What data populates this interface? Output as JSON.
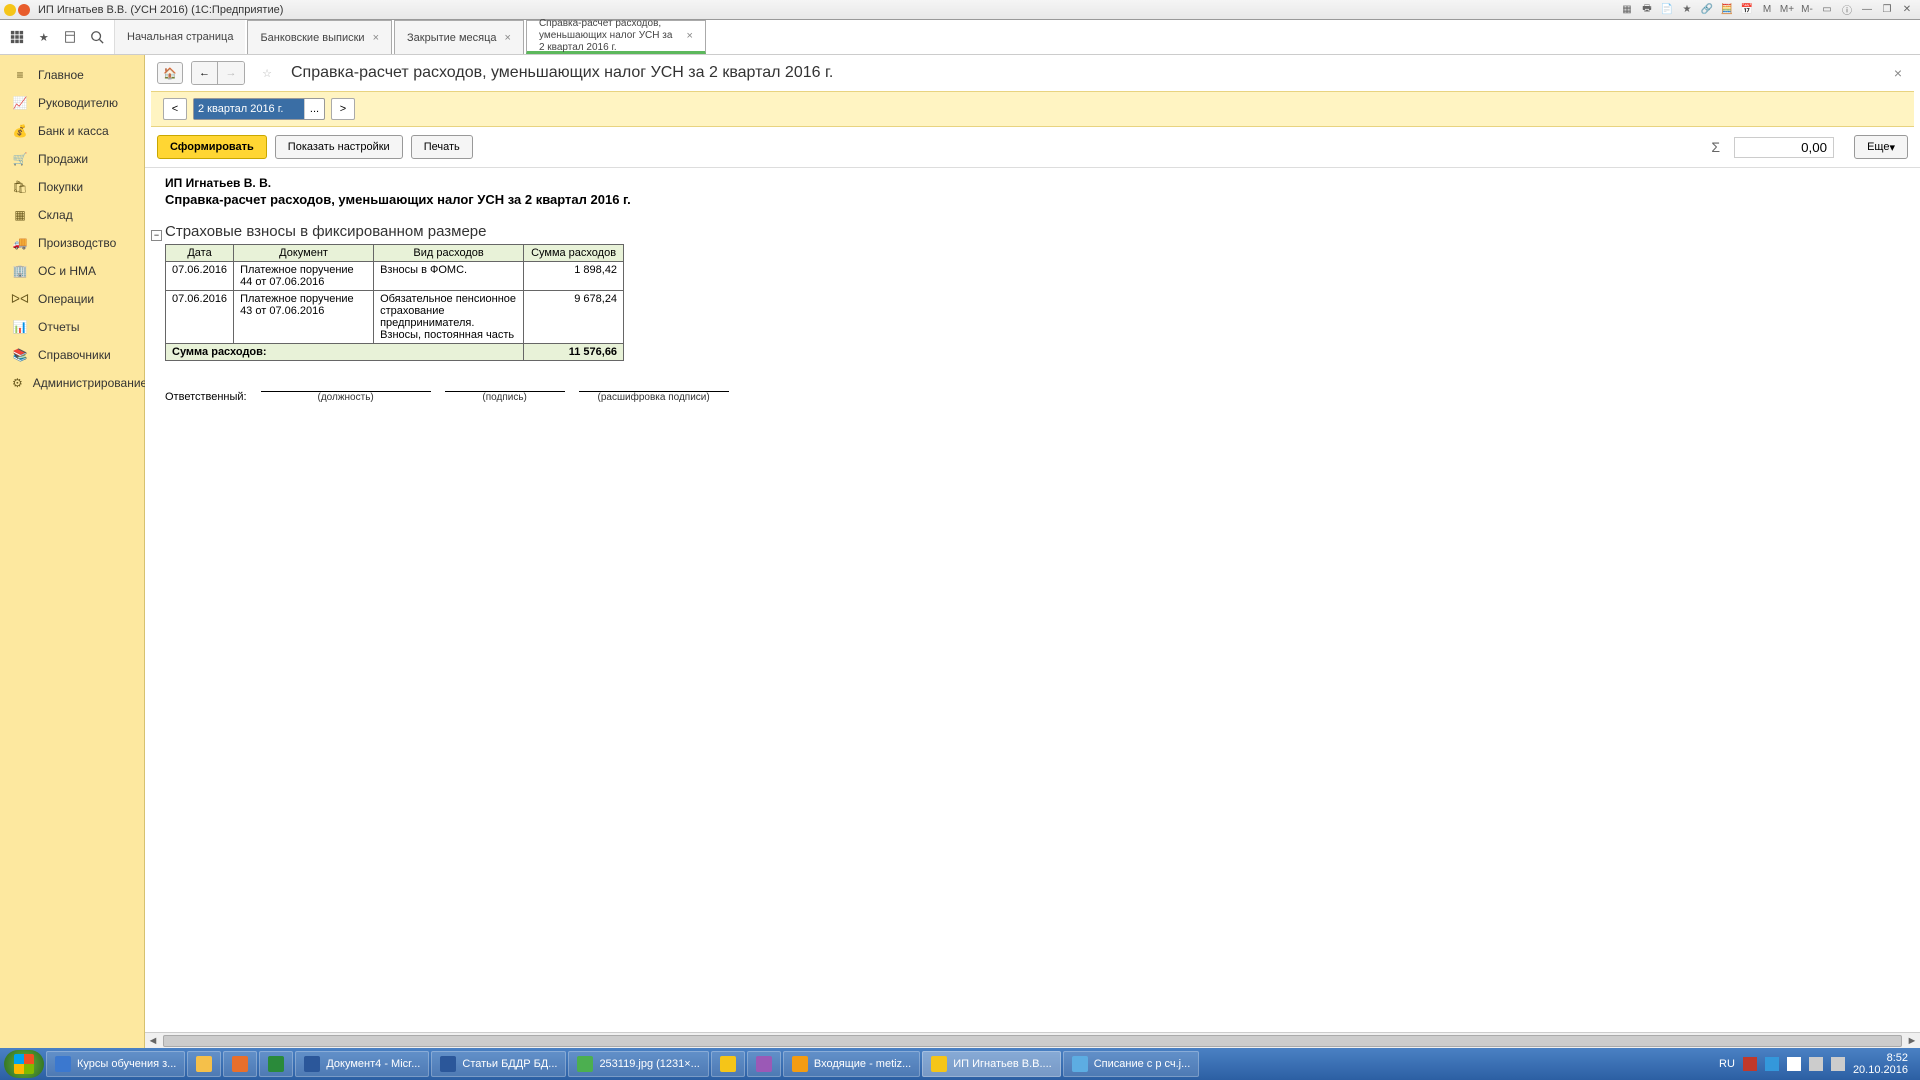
{
  "titlebar": {
    "title": "ИП Игнатьев В.В. (УСН 2016)  (1С:Предприятие)",
    "memory_labels": [
      "M",
      "M+",
      "M-"
    ]
  },
  "tabs": [
    {
      "label": "Начальная страница",
      "closeable": false
    },
    {
      "label": "Банковские выписки",
      "closeable": true
    },
    {
      "label": "Закрытие месяца",
      "closeable": true
    },
    {
      "label": "Справка-расчет расходов, уменьшающих налог УСН  за 2 квартал 2016 г.",
      "closeable": true,
      "active": true
    }
  ],
  "sidebar": [
    {
      "icon": "menu",
      "label": "Главное"
    },
    {
      "icon": "trend",
      "label": "Руководителю"
    },
    {
      "icon": "bank",
      "label": "Банк и касса"
    },
    {
      "icon": "cart",
      "label": "Продажи"
    },
    {
      "icon": "basket",
      "label": "Покупки"
    },
    {
      "icon": "boxes",
      "label": "Склад"
    },
    {
      "icon": "truck",
      "label": "Производство"
    },
    {
      "icon": "asset",
      "label": "ОС и НМА"
    },
    {
      "icon": "ops",
      "label": "Операции"
    },
    {
      "icon": "chart",
      "label": "Отчеты"
    },
    {
      "icon": "book",
      "label": "Справочники"
    },
    {
      "icon": "gear",
      "label": "Администрирование"
    }
  ],
  "page": {
    "title": "Справка-расчет расходов, уменьшающих налог УСН  за 2 квартал 2016 г.",
    "period_prev": "<",
    "period_value": "2 квартал 2016 г.",
    "period_next": ">",
    "btn_generate": "Сформировать",
    "btn_settings": "Показать настройки",
    "btn_print": "Печать",
    "sum_value": "0,00",
    "btn_more": "Еще"
  },
  "report": {
    "company": "ИП Игнатьев В. В.",
    "subtitle": "Справка-расчет расходов, уменьшающих налог УСН  за 2 квартал 2016 г.",
    "section": "Страховые взносы в фиксированном размере",
    "columns": [
      "Дата",
      "Документ",
      "Вид расходов",
      "Сумма расходов"
    ],
    "rows": [
      {
        "date": "07.06.2016",
        "doc": "Платежное поручение 44 от 07.06.2016",
        "kind": "Взносы в ФОМС.",
        "sum": "1 898,42"
      },
      {
        "date": "07.06.2016",
        "doc": "Платежное поручение 43 от 07.06.2016",
        "kind": "Обязательное пенсионное страхование предпринимателя. Взносы, постоянная часть",
        "sum": "9 678,24"
      }
    ],
    "total_label": "Сумма расходов:",
    "total_value": "11 576,66",
    "responsible_label": "Ответственный:",
    "sig_captions": [
      "(должность)",
      "(подпись)",
      "(расшифровка подписи)"
    ]
  },
  "taskbar": {
    "items": [
      {
        "label": "Курсы обучения з...",
        "color": "#3b78cf"
      },
      {
        "label": "",
        "color": "#f5c04a"
      },
      {
        "label": "",
        "color": "#e86f2b"
      },
      {
        "label": "",
        "color": "#2a8a3a"
      },
      {
        "label": "Документ4 - Мicr...",
        "color": "#2b579a"
      },
      {
        "label": "Статьи БДДР БД...",
        "color": "#2b579a"
      },
      {
        "label": "253119.jpg (1231×...",
        "color": "#4caf50"
      },
      {
        "label": "",
        "color": "#f5c518"
      },
      {
        "label": "",
        "color": "#9b59b6"
      },
      {
        "label": "Входящие - metiz...",
        "color": "#f39c12"
      },
      {
        "label": "ИП Игнатьев В.В....",
        "color": "#f5c518",
        "active": true
      },
      {
        "label": "Списание с р сч.j...",
        "color": "#5dade2"
      }
    ],
    "lang": "RU",
    "time": "8:52",
    "date": "20.10.2016"
  }
}
